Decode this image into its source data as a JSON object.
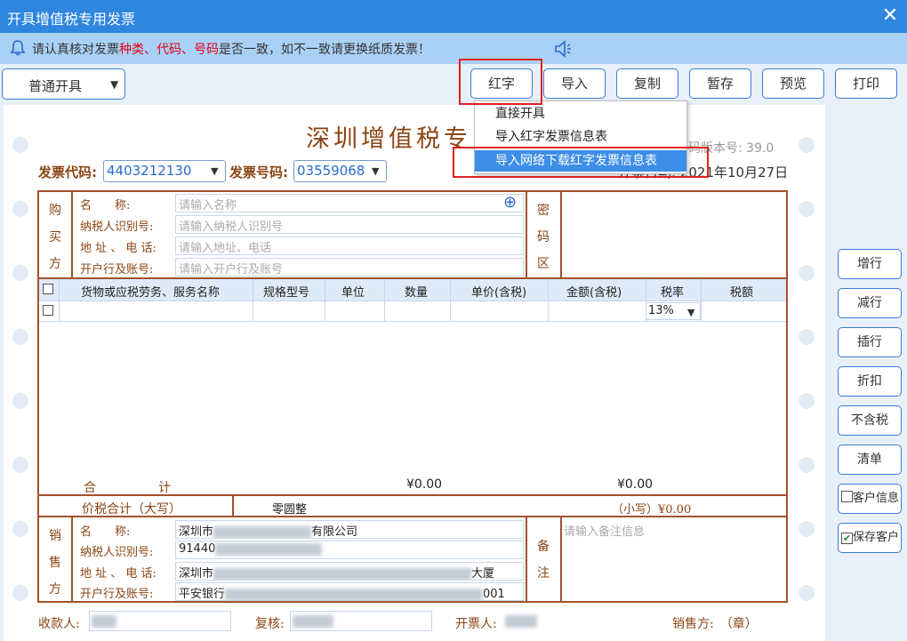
{
  "window": {
    "title": "开具增值税专用发票",
    "close": "✕"
  },
  "notice": {
    "prefix": "请认真核对发票",
    "highlight": "种类、代码、号码",
    "suffix": "是否一致，如不一致请更换纸质发票！"
  },
  "toolbar": {
    "mode": "普通开具",
    "buttons": [
      "红字",
      "导入",
      "复制",
      "暂存",
      "预览",
      "打印"
    ]
  },
  "dropdown": {
    "items": [
      "直接开具",
      "导入红字发票信息表",
      "导入网络下载红字发票信息表"
    ]
  },
  "invoice": {
    "title": "深圳增值税专",
    "version": "编码版本号: 39.0",
    "code_label": "发票代码:",
    "code": "4403212130",
    "number_label": "发票号码:",
    "number": "03559068",
    "date": "开票日期: 2021年10月27日"
  },
  "buyer": {
    "section": [
      "购",
      "买",
      "方"
    ],
    "labels": [
      "名　　称:",
      "纳税人识别号:",
      "地 址 、 电 话:",
      "开户行及账号:"
    ],
    "placeholders": [
      "请输入名称",
      "请输入纳税人识别号",
      "请输入地址、电话",
      "请输入开户行及账号"
    ],
    "add": "⊕"
  },
  "cipher": [
    "密",
    "码",
    "区"
  ],
  "items": {
    "headers": [
      "货物或应税劳务、服务名称",
      "规格型号",
      "单位",
      "数量",
      "单价(含税)",
      "金额(含税)",
      "税率",
      "税额"
    ],
    "tax_rate": "13%"
  },
  "totals": {
    "label": "合　　　　　计",
    "amount": "¥0.00",
    "tax": "¥0.00",
    "words_label": "价税合计（大写）",
    "words": "零圆整",
    "small_label": "（小写）¥0.00"
  },
  "seller": {
    "section": [
      "销",
      "售",
      "方"
    ],
    "labels": [
      "名　　称:",
      "纳税人识别号:",
      "地 址 、 电 话:",
      "开户行及账号:"
    ],
    "values": [
      "深圳市",
      "有限公司",
      "91440",
      "深圳市",
      "大厦",
      "平安银行",
      "001"
    ]
  },
  "remark": {
    "section": [
      "备",
      "注"
    ],
    "placeholder": "请输入备注信息"
  },
  "side_buttons": [
    "增行",
    "减行",
    "插行",
    "折扣",
    "不含税",
    "清单",
    "客户信息",
    "保存客户"
  ],
  "footer": {
    "payee": "收款人:",
    "reviewer": "复核:",
    "issuer": "开票人:",
    "seller": "销售方:　（章）"
  },
  "colors": {
    "titlebar": "#2e86df",
    "notice": "#a9d1f5",
    "border": "#a0522d",
    "accent": "#3a7bd5",
    "highlight": "#e02020"
  }
}
